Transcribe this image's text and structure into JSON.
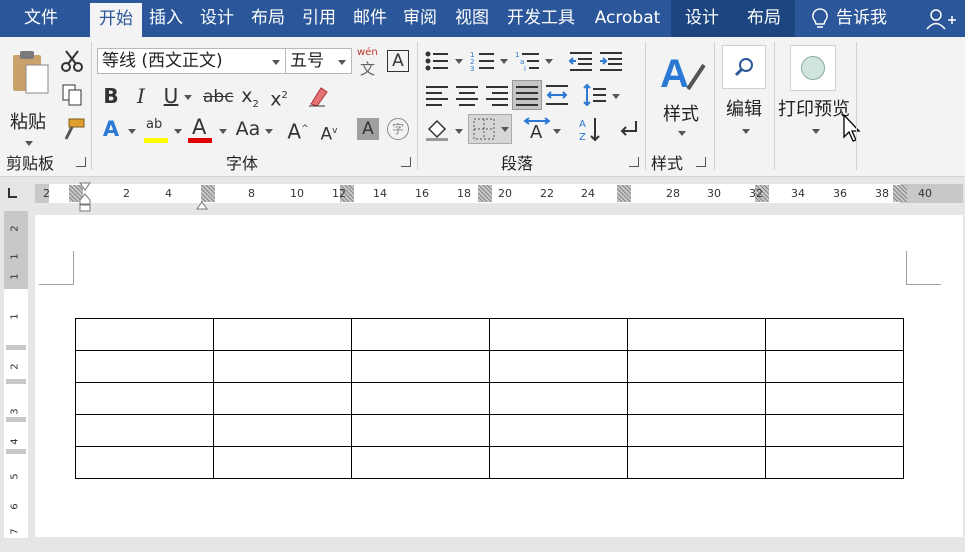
{
  "tabs": [
    {
      "label": "文件",
      "active": false
    },
    {
      "label": "开始",
      "active": true
    },
    {
      "label": "插入",
      "active": false
    },
    {
      "label": "设计",
      "active": false
    },
    {
      "label": "布局",
      "active": false
    },
    {
      "label": "引用",
      "active": false
    },
    {
      "label": "邮件",
      "active": false
    },
    {
      "label": "审阅",
      "active": false
    },
    {
      "label": "视图",
      "active": false
    },
    {
      "label": "开发工具",
      "active": false
    },
    {
      "label": "Acrobat",
      "active": false
    },
    {
      "label": "设计",
      "active": false,
      "contextual": true
    },
    {
      "label": "布局",
      "active": false,
      "contextual": true
    }
  ],
  "tell_me": "告诉我",
  "clipboard": {
    "paste_label": "粘贴",
    "group_label": "剪贴板"
  },
  "font": {
    "family": "等线 (西文正文)",
    "size": "五号",
    "phonetic_top": "wén",
    "phonetic_bottom": "文",
    "group_label": "字体",
    "enclosed_char": "字"
  },
  "paragraph": {
    "group_label": "段落"
  },
  "styles": {
    "label": "样式",
    "group_label": "样式"
  },
  "editing": {
    "label": "编辑"
  },
  "print_preview": {
    "label": "打印预览"
  },
  "ruler": {
    "numbers": [
      "2",
      "2",
      "4",
      "8",
      "10",
      "12",
      "14",
      "16",
      "18",
      "20",
      "22",
      "24",
      "28",
      "30",
      "32",
      "34",
      "36",
      "38",
      "40"
    ]
  },
  "vruler": {
    "numbers": [
      "2",
      "1",
      "1",
      "1",
      "2",
      "3",
      "4",
      "5",
      "6",
      "7"
    ]
  },
  "table": {
    "rows": 5,
    "cols": 6
  },
  "colors": {
    "accent": "#2b579a",
    "highlight": "#ffff00",
    "font_color": "#ff0000"
  }
}
